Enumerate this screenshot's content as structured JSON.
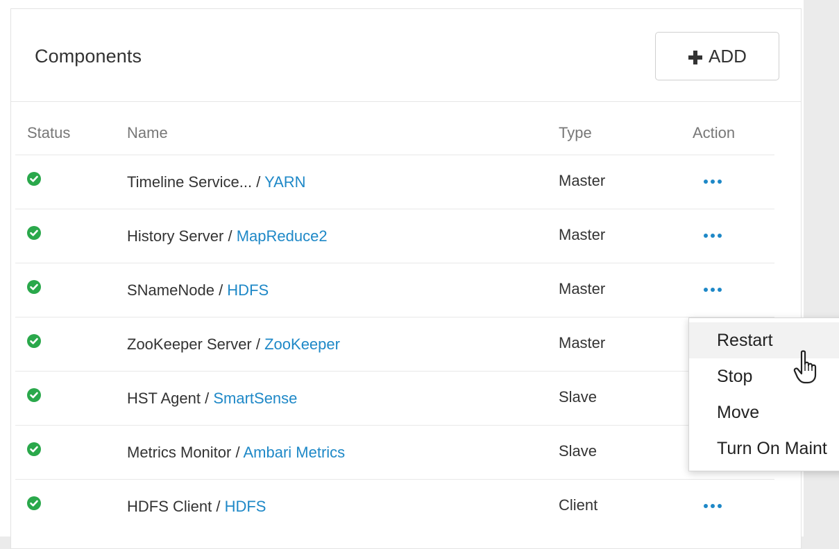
{
  "panel": {
    "title": "Components",
    "add_label": "ADD",
    "add_icon": "plus-icon"
  },
  "table": {
    "headers": {
      "status": "Status",
      "name": "Name",
      "type": "Type",
      "action": "Action"
    },
    "rows": [
      {
        "name": "Timeline Service... / ",
        "service": "YARN",
        "type": "Master",
        "status": "started",
        "action_visible": true
      },
      {
        "name": "History Server / ",
        "service": "MapReduce2",
        "type": "Master",
        "status": "started",
        "action_visible": true
      },
      {
        "name": "SNameNode / ",
        "service": "HDFS",
        "type": "Master",
        "status": "started",
        "action_visible": true
      },
      {
        "name": "ZooKeeper Server / ",
        "service": "ZooKeeper",
        "type": "Master",
        "status": "started",
        "action_visible": false
      },
      {
        "name": "HST Agent / ",
        "service": "SmartSense",
        "type": "Slave",
        "status": "started",
        "action_visible": false
      },
      {
        "name": "Metrics Monitor / ",
        "service": "Ambari Metrics",
        "type": "Slave",
        "status": "started",
        "action_visible": false
      },
      {
        "name": "HDFS Client / ",
        "service": "HDFS",
        "type": "Client",
        "status": "started",
        "action_visible": true
      }
    ]
  },
  "action_menu": {
    "items": [
      {
        "label": "Restart",
        "hovered": true
      },
      {
        "label": "Stop",
        "hovered": false
      },
      {
        "label": "Move",
        "hovered": false
      },
      {
        "label": "Turn On Maint",
        "hovered": false
      }
    ]
  },
  "colors": {
    "link": "#1e88c7",
    "status_ok": "#2aa84b",
    "text": "#333333",
    "header_text": "#777777"
  }
}
